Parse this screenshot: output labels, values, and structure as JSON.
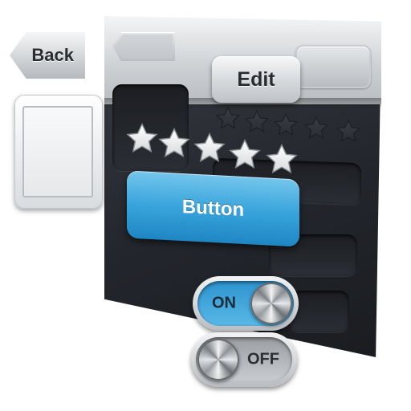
{
  "nav": {
    "back_label": "Back",
    "edit_label": "Edit"
  },
  "content": {
    "primary_button_label": "Button"
  },
  "rating_bright": {
    "value": 5,
    "max": 5
  },
  "rating_dark": {
    "value": 0,
    "max": 5
  },
  "toggles": {
    "on_label": "ON",
    "off_label": "OFF"
  },
  "colors": {
    "accent_blue": "#39a4dc",
    "panel_dark": "#23262c",
    "metal_light": "#d3d6d9",
    "star_bright": "#d7dadd",
    "star_dark": "#2a2d32"
  },
  "icons": {
    "star": "star-icon",
    "back": "back-arrow",
    "knob": "metal-knob"
  }
}
